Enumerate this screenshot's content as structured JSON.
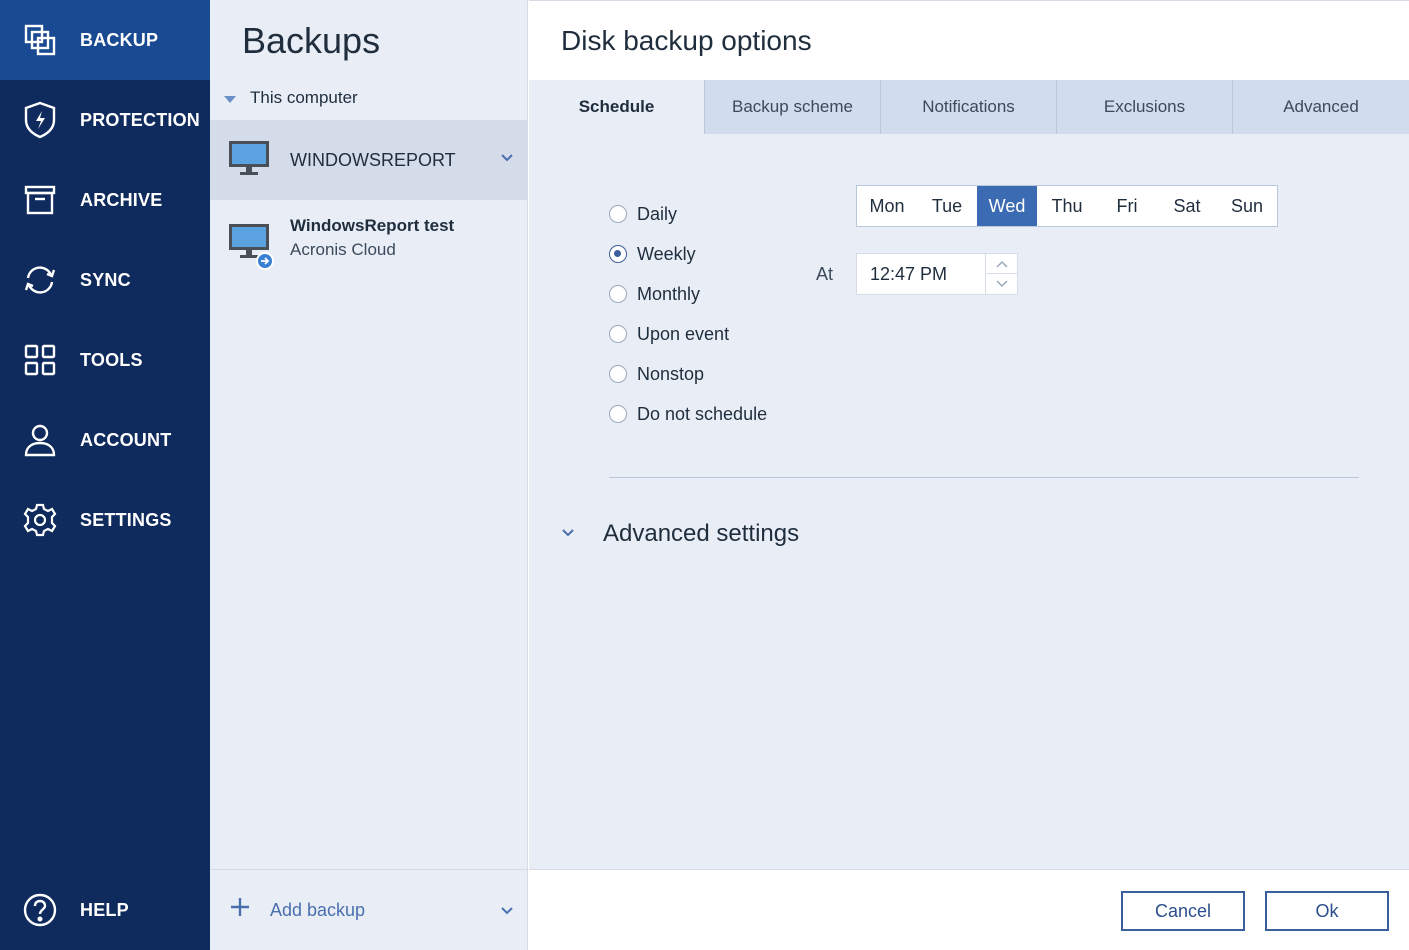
{
  "nav": {
    "items": [
      {
        "label": "BACKUP",
        "icon": "backup-icon"
      },
      {
        "label": "PROTECTION",
        "icon": "shield-icon"
      },
      {
        "label": "ARCHIVE",
        "icon": "archive-icon"
      },
      {
        "label": "SYNC",
        "icon": "sync-icon"
      },
      {
        "label": "TOOLS",
        "icon": "tools-icon"
      },
      {
        "label": "ACCOUNT",
        "icon": "account-icon"
      },
      {
        "label": "SETTINGS",
        "icon": "gear-icon"
      }
    ],
    "help": "HELP",
    "active_index": 0
  },
  "backups": {
    "title": "Backups",
    "group": "This computer",
    "items": [
      {
        "name": "WINDOWSREPORT"
      },
      {
        "name": "WindowsReport test",
        "destination": "Acronis Cloud"
      }
    ],
    "add_label": "Add backup"
  },
  "options": {
    "title": "Disk backup options",
    "tabs": [
      "Schedule",
      "Backup scheme",
      "Notifications",
      "Exclusions",
      "Advanced"
    ],
    "active_tab": "Schedule",
    "schedule": {
      "options": [
        "Daily",
        "Weekly",
        "Monthly",
        "Upon event",
        "Nonstop",
        "Do not schedule"
      ],
      "selected": "Weekly",
      "days": [
        "Mon",
        "Tue",
        "Wed",
        "Thu",
        "Fri",
        "Sat",
        "Sun"
      ],
      "selected_day": "Wed",
      "at_label": "At",
      "time": "12:47 PM"
    },
    "advanced_settings": "Advanced settings"
  },
  "footer": {
    "cancel": "Cancel",
    "ok": "Ok"
  },
  "colors": {
    "nav_bg": "#0f2a5c",
    "nav_active": "#1a4a91",
    "panel_bg": "#e9eef6",
    "accent": "#3b6cb3"
  }
}
